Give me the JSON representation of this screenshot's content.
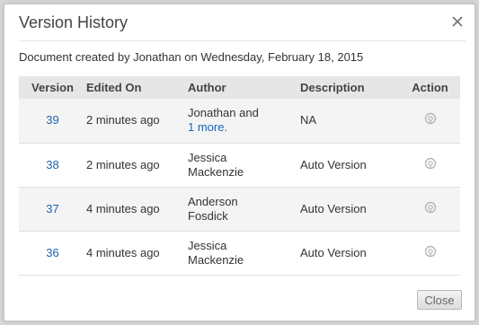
{
  "dialog": {
    "title": "Version History",
    "created_text": "Document created by Jonathan on Wednesday, February 18, 2015",
    "close_button_label": "Close",
    "close_icon": "close-x-icon"
  },
  "table": {
    "headers": {
      "version": "Version",
      "edited_on": "Edited On",
      "author": "Author",
      "description": "Description",
      "action": "Action"
    },
    "rows": [
      {
        "version": "39",
        "edited_on": "2 minutes ago",
        "author_line1": "Jonathan and",
        "author_more": "1 more.",
        "description": "NA",
        "action_icon": "restore-icon"
      },
      {
        "version": "38",
        "edited_on": "2 minutes ago",
        "author_line1": "Jessica",
        "author_line2": "Mackenzie",
        "description": "Auto Version",
        "action_icon": "restore-icon"
      },
      {
        "version": "37",
        "edited_on": "4 minutes ago",
        "author_line1": "Anderson",
        "author_line2": "Fosdick",
        "description": "Auto Version",
        "action_icon": "restore-icon"
      },
      {
        "version": "36",
        "edited_on": "4 minutes ago",
        "author_line1": "Jessica",
        "author_line2": "Mackenzie",
        "description": "Auto Version",
        "action_icon": "restore-icon"
      }
    ]
  },
  "colors": {
    "link": "#1a66b3",
    "header_bg": "#e6e6e6",
    "row_alt_bg": "#f4f4f4"
  }
}
